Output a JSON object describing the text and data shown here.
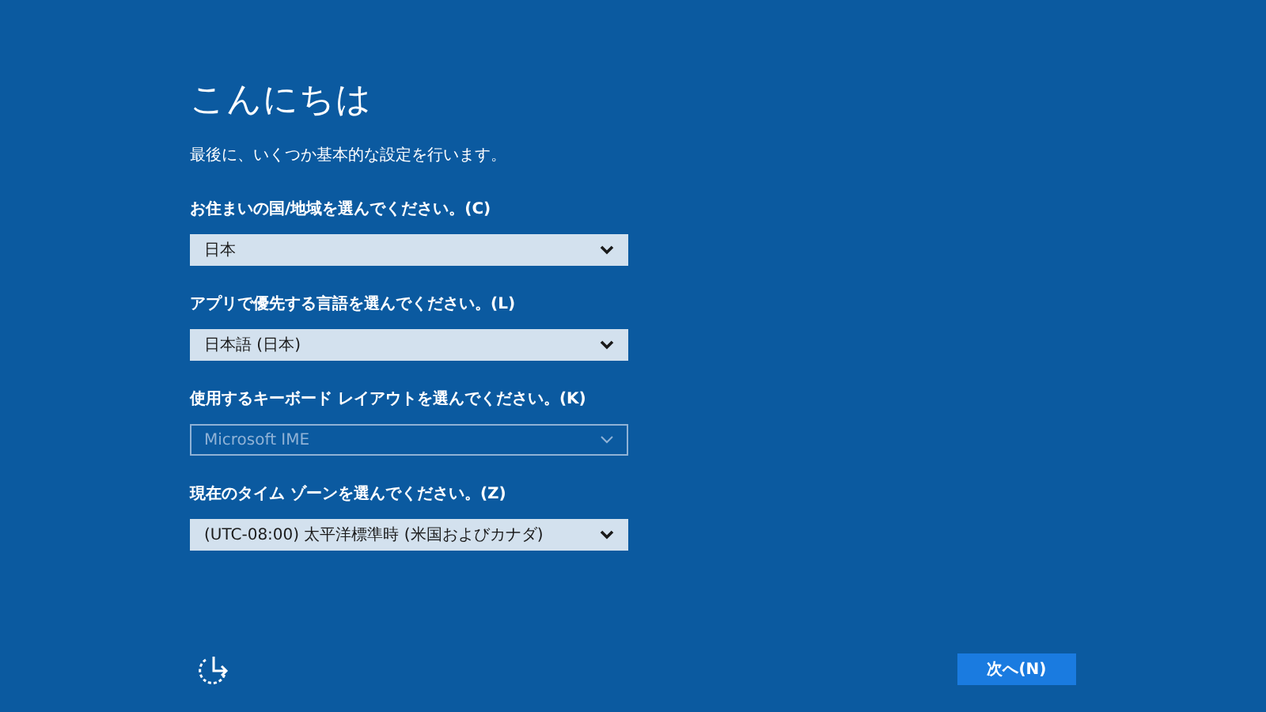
{
  "title": "こんにちは",
  "subtitle": "最後に、いくつか基本的な設定を行います。",
  "fields": [
    {
      "label": "お住まいの国/地域を選んでください。(C)",
      "value": "日本",
      "disabled": false
    },
    {
      "label": "アプリで優先する言語を選んでください。(L)",
      "value": "日本語 (日本)",
      "disabled": false
    },
    {
      "label": "使用するキーボード レイアウトを選んでください。(K)",
      "value": "Microsoft IME",
      "disabled": true
    },
    {
      "label": "現在のタイム ゾーンを選んでください。(Z)",
      "value": "(UTC-08:00) 太平洋標準時 (米国およびカナダ)",
      "disabled": false
    }
  ],
  "next_button": "次へ(N)"
}
